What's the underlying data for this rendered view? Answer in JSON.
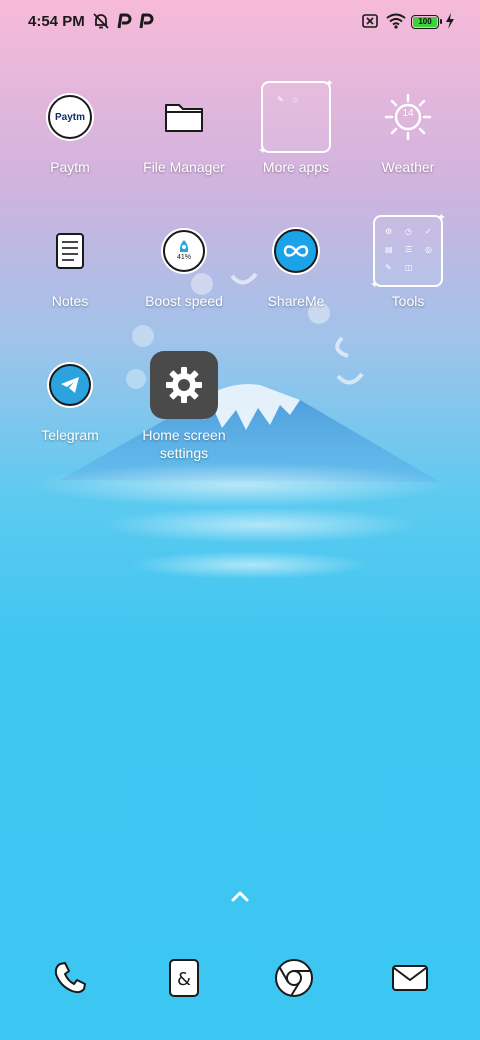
{
  "status_bar": {
    "time": "4:54 PM",
    "icons": [
      "alarm-off-icon",
      "paytm-p-icon",
      "paytm-p-icon"
    ],
    "right_icons": [
      "sim-x-icon",
      "wifi-icon",
      "battery-icon",
      "charging-bolt-icon"
    ],
    "battery_level": "100"
  },
  "apps": [
    {
      "label": "Paytm",
      "icon": "paytm-icon",
      "icon_text": "Paytm"
    },
    {
      "label": "File Manager",
      "icon": "folder-icon"
    },
    {
      "label": "More apps",
      "icon": "folder-more-apps-icon"
    },
    {
      "label": "Weather",
      "icon": "sun-icon",
      "icon_text": "14"
    },
    {
      "label": "Notes",
      "icon": "notes-icon"
    },
    {
      "label": "Boost speed",
      "icon": "rocket-icon",
      "icon_text": "41%"
    },
    {
      "label": "ShareMe",
      "icon": "infinity-icon"
    },
    {
      "label": "Tools",
      "icon": "folder-tools-icon"
    },
    {
      "label": "Telegram",
      "icon": "telegram-icon"
    },
    {
      "label": "Home screen settings",
      "icon": "gear-icon"
    }
  ],
  "dock": [
    {
      "icon": "phone-icon"
    },
    {
      "icon": "contacts-icon"
    },
    {
      "icon": "chrome-icon"
    },
    {
      "icon": "mail-icon"
    }
  ],
  "colors": {
    "bg_top": "#f7bad9",
    "bg_bottom": "#3cc6f2",
    "settings_tile": "#4a4a4a",
    "shareme_blue": "#1aa3e8",
    "telegram_blue": "#2aa3df",
    "paytm_navy": "#0b2f6e"
  }
}
